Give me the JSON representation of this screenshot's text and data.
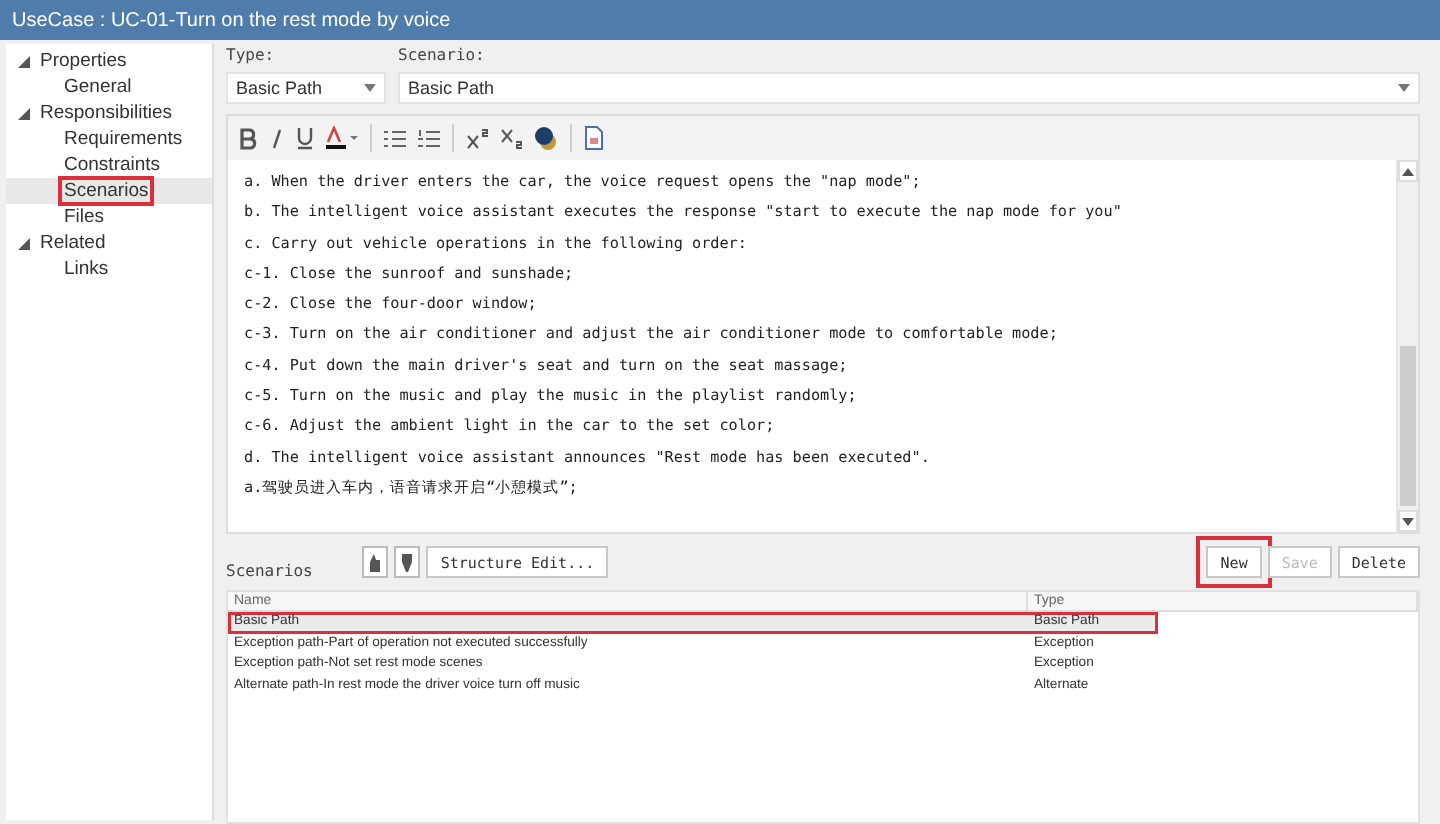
{
  "window": {
    "title": "UseCase : UC-01-Turn on the rest mode by voice"
  },
  "tree": [
    {
      "label": "Properties",
      "expanded": true,
      "selected": false,
      "highlighted": false,
      "children": [
        {
          "label": "General",
          "selected": false,
          "highlighted": false
        }
      ]
    },
    {
      "label": "Responsibilities",
      "expanded": true,
      "selected": false,
      "highlighted": false,
      "children": [
        {
          "label": "Requirements",
          "selected": false,
          "highlighted": false
        },
        {
          "label": "Constraints",
          "selected": false,
          "highlighted": false
        },
        {
          "label": "Scenarios",
          "selected": true,
          "highlighted": true
        },
        {
          "label": "Files",
          "selected": false,
          "highlighted": false
        }
      ]
    },
    {
      "label": "Related",
      "expanded": true,
      "selected": false,
      "highlighted": false,
      "children": [
        {
          "label": "Links",
          "selected": false,
          "highlighted": false
        }
      ]
    }
  ],
  "type_field": {
    "label": "Type:",
    "value": "Basic Path"
  },
  "scenario_field": {
    "label": "Scenario:",
    "value": "Basic Path"
  },
  "editor": {
    "lines": [
      "a. When the driver enters the car, the voice request opens the \"nap mode\";",
      "b. The intelligent voice assistant executes the response \"start to execute the nap mode for you\"",
      "c. Carry out vehicle operations in the following order:",
      "c-1. Close the sunroof and sunshade;",
      "c-2. Close the four-door window;",
      "c-3. Turn on the air conditioner and adjust the air conditioner mode to comfortable mode;",
      "c-4. Put down the main driver's seat and turn on the seat massage;",
      "c-5. Turn on the music and play the music in the playlist randomly;",
      "c-6. Adjust the ambient light in the car to the set color;",
      "d. The intelligent voice assistant announces \"Rest mode has been executed\".",
      "a.驾驶员进入车内，语音请求开启“小憩模式”;"
    ]
  },
  "scenarios": {
    "label": "Scenarios",
    "structure_button": "Structure Edit...",
    "buttons": [
      {
        "label": "New",
        "disabled": false,
        "highlighted": true
      },
      {
        "label": "Save",
        "disabled": true,
        "highlighted": false
      },
      {
        "label": "Delete",
        "disabled": false,
        "highlighted": false
      }
    ],
    "columns": [
      "Name",
      "Type"
    ],
    "rows": [
      {
        "name": "Basic Path",
        "type": "Basic Path",
        "selected": true,
        "highlighted": true
      },
      {
        "name": "Exception path-Part of operation not executed successfully",
        "type": "Exception",
        "selected": false,
        "highlighted": false
      },
      {
        "name": "Exception path-Not set rest mode scenes",
        "type": "Exception",
        "selected": false,
        "highlighted": false
      },
      {
        "name": "Alternate path-In  rest mode the driver voice turn off music",
        "type": "Alternate",
        "selected": false,
        "highlighted": false
      }
    ]
  }
}
